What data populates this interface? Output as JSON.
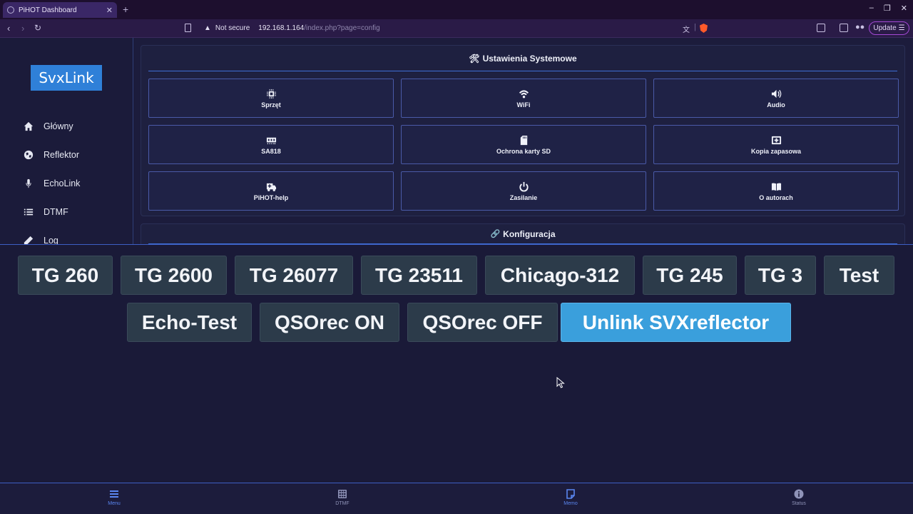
{
  "browser": {
    "tab_title": "PiHOT Dashboard",
    "tab_close": "✕",
    "new_tab": "+",
    "window_controls": [
      "–",
      "❐",
      "✕"
    ],
    "security_label": "Not secure",
    "url_host": "192.168.1.164",
    "url_path": "/index.php?page=config",
    "update_label": "Update"
  },
  "sidebar": {
    "logo": "SvxLink",
    "items": [
      {
        "label": "Główny",
        "icon": "home-icon"
      },
      {
        "label": "Reflektor",
        "icon": "globe-icon"
      },
      {
        "label": "EchoLink",
        "icon": "microphone-icon"
      },
      {
        "label": "DTMF",
        "icon": "list-icon"
      },
      {
        "label": "Log",
        "icon": "pencil-icon"
      }
    ]
  },
  "system_panel": {
    "icon": "🛠",
    "title": "Ustawienia Systemowe",
    "tiles": [
      {
        "label": "Sprzęt",
        "icon": "chip-icon"
      },
      {
        "label": "WiFi",
        "icon": "wifi-icon"
      },
      {
        "label": "Audio",
        "icon": "speaker-icon"
      },
      {
        "label": "SA818",
        "icon": "memory-icon"
      },
      {
        "label": "Ochrona karty SD",
        "icon": "sd-card-icon"
      },
      {
        "label": "Kopia zapasowa",
        "icon": "backup-icon"
      },
      {
        "label": "PiHOT-help",
        "icon": "truck-medical-icon"
      },
      {
        "label": "Zasilanie",
        "icon": "power-icon"
      },
      {
        "label": "O autorach",
        "icon": "book-icon"
      }
    ]
  },
  "config_panel": {
    "icon": "🔗",
    "title": "Konfiguracja"
  },
  "memo": {
    "buttons": [
      "TG 260",
      "TG 2600",
      "TG 26077",
      "TG 23511",
      "Chicago-312",
      "TG 245",
      "TG 3",
      "Test",
      "Echo-Test",
      "QSOrec ON",
      "QSOrec OFF",
      "Unlink SVXreflector"
    ],
    "active_button": "Unlink SVXreflector",
    "colors": {
      "button": "#2c3b4a",
      "active": "#3a9fdc"
    }
  },
  "bottom_nav": {
    "items": [
      {
        "label": "Menu",
        "icon": "menu-icon"
      },
      {
        "label": "DTMF",
        "icon": "keypad-icon"
      },
      {
        "label": "Memo",
        "icon": "memo-icon"
      },
      {
        "label": "Status",
        "icon": "info-icon"
      }
    ],
    "active": "Memo"
  }
}
